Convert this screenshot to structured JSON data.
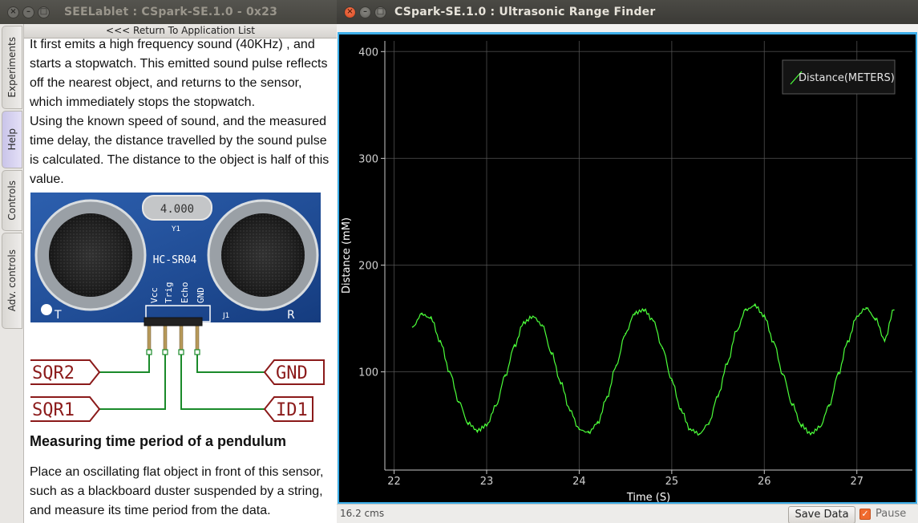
{
  "left_window": {
    "title": "SEELablet : CSpark-SE.1.0 - 0x23",
    "window_buttons": [
      "×",
      "–",
      "□"
    ],
    "tabs": [
      {
        "label": "Experiments"
      },
      {
        "label": "Help"
      },
      {
        "label": "Controls"
      },
      {
        "label": "Adv. controls"
      }
    ],
    "return_link": "<<< Return To Application List",
    "help": {
      "paragraphs": [
        "It first emits a high frequency sound (40KHz) , and starts a stopwatch. This emitted sound pulse reflects off the nearest object, and returns to the sensor, which immediately stops the stopwatch.",
        "Using the known speed of sound, and the measured time delay, the distance travelled by the sound pulse is calculated. The distance to the object is half of this value."
      ],
      "figure": {
        "crystal_label": "4.000",
        "y1_label": "Y1",
        "module_label": "HC-SR04",
        "pin_labels": [
          "Vcc",
          "Trig",
          "Echo",
          "GND"
        ],
        "j1_label": "J1",
        "t_label": "T",
        "r_label": "R",
        "connectors": [
          "SQR2",
          "SQR1",
          "GND",
          "ID1"
        ]
      },
      "heading": "Measuring time period of a pendulum",
      "body2": "Place an oscillating flat object in front of this sensor, such as a blackboard duster suspended by a string, and measure its time period from the data."
    }
  },
  "right_window": {
    "title": "CSpark-SE.1.0 : Ultrasonic Range Finder",
    "window_buttons": [
      "×",
      "–",
      "□"
    ],
    "status_text": "16.2 cms",
    "save_label": "Save Data",
    "pause_label": "Pause",
    "pause_checked": true
  },
  "chart_data": {
    "type": "line",
    "title": "",
    "xlabel": "Time (S)",
    "ylabel": "Distance (mM)",
    "xlim": [
      21.9,
      27.6
    ],
    "ylim": [
      8,
      410
    ],
    "xticks": [
      22,
      23,
      24,
      25,
      26,
      27
    ],
    "yticks": [
      100,
      200,
      300,
      400
    ],
    "grid": true,
    "legend_position": "top-right",
    "series": [
      {
        "name": "Distance(METERS)",
        "color": "#4cff3a",
        "x": [
          22.2,
          22.3,
          22.4,
          22.5,
          22.6,
          22.7,
          22.8,
          22.9,
          23.0,
          23.1,
          23.2,
          23.3,
          23.4,
          23.5,
          23.6,
          23.7,
          23.8,
          23.9,
          24.0,
          24.1,
          24.2,
          24.3,
          24.4,
          24.5,
          24.6,
          24.7,
          24.8,
          24.9,
          25.0,
          25.1,
          25.2,
          25.3,
          25.4,
          25.5,
          25.6,
          25.7,
          25.8,
          25.9,
          26.0,
          26.1,
          26.2,
          26.3,
          26.4,
          26.5,
          26.6,
          26.7,
          26.8,
          26.9,
          27.0,
          27.1,
          27.2,
          27.3,
          27.4
        ],
        "values": [
          142,
          154,
          150,
          128,
          100,
          72,
          52,
          45,
          50,
          68,
          96,
          124,
          146,
          152,
          144,
          118,
          90,
          64,
          46,
          43,
          52,
          76,
          106,
          136,
          155,
          158,
          148,
          122,
          92,
          64,
          46,
          42,
          52,
          78,
          108,
          138,
          158,
          162,
          152,
          128,
          98,
          70,
          50,
          42,
          48,
          68,
          98,
          128,
          152,
          160,
          150,
          130,
          158
        ]
      }
    ]
  }
}
